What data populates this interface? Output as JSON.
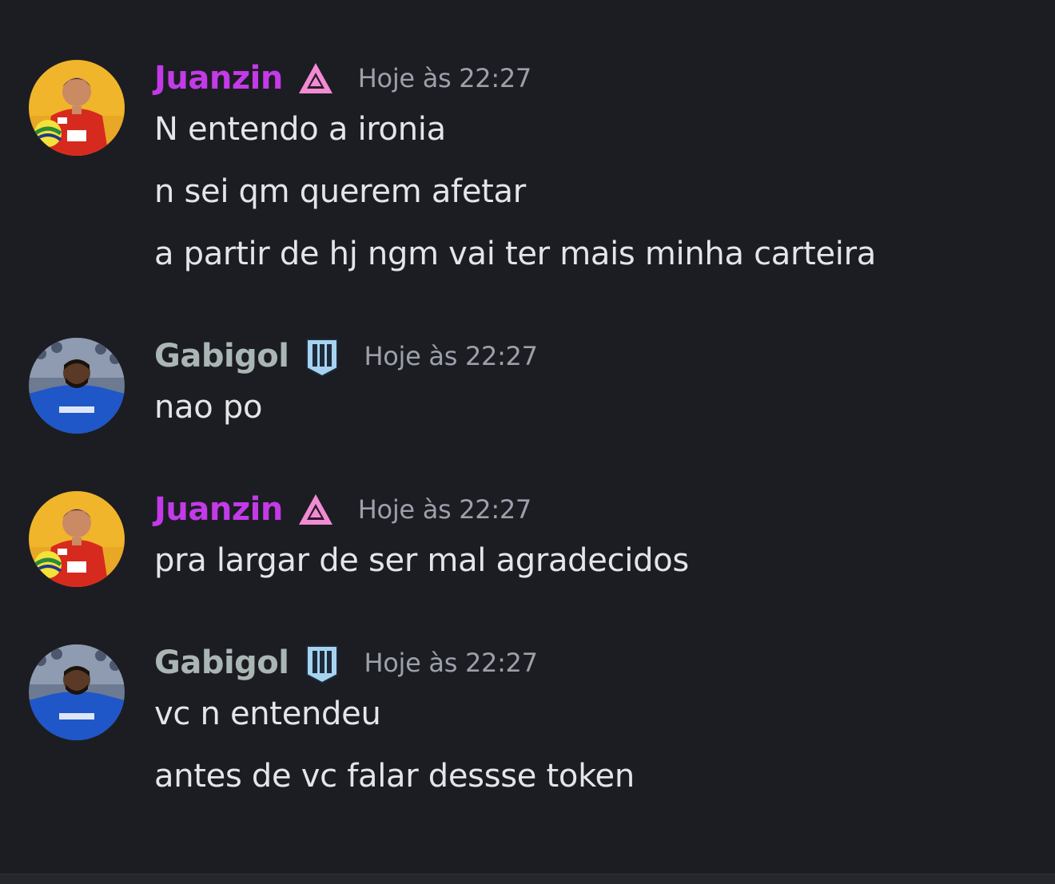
{
  "colors": {
    "background": "#1c1d22",
    "juanzin_name": "#c33ae8",
    "gabigol_name": "#aab6b3",
    "message_text": "#e4e5e9",
    "timestamp": "#9ca0ab"
  },
  "messages": [
    {
      "author": "Juanzin",
      "badge_icon": "pink-triangle-icon",
      "timestamp": "Hoje às 22:27",
      "lines": [
        "N entendo a ironia",
        "n sei qm querem afetar",
        "a partir de hj ngm vai ter mais minha carteira"
      ]
    },
    {
      "author": "Gabigol",
      "badge_icon": "blue-stripes-shield-icon",
      "timestamp": "Hoje às 22:27",
      "lines": [
        "nao po"
      ]
    },
    {
      "author": "Juanzin",
      "badge_icon": "pink-triangle-icon",
      "timestamp": "Hoje às 22:27",
      "lines": [
        "pra largar de ser mal agradecidos"
      ]
    },
    {
      "author": "Gabigol",
      "badge_icon": "blue-stripes-shield-icon",
      "timestamp": "Hoje às 22:27",
      "lines": [
        "vc n entendeu",
        "antes de vc falar dessse token"
      ]
    }
  ]
}
